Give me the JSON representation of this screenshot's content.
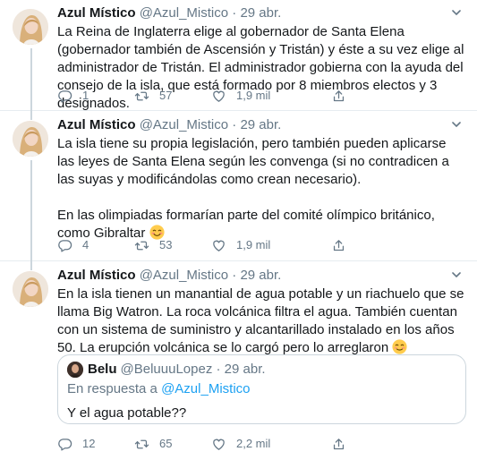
{
  "tweets": [
    {
      "author": {
        "name": "Azul Místico",
        "handle": "@Azul_Mistico"
      },
      "separator": "·",
      "date": "29 abr.",
      "paragraphs": [
        "La Reina de Inglaterra elige al gobernador de Santa Elena (gobernador también de Ascensión y Tristán) y éste a su vez elige al administrador de Tristán. El administrador gobierna con la ayuda del consejo de la isla, que está formado por 8 miembros electos y 3 designados."
      ],
      "stats": {
        "replies": "1",
        "retweets": "57",
        "likes": "1,9 mil"
      }
    },
    {
      "author": {
        "name": "Azul Místico",
        "handle": "@Azul_Mistico"
      },
      "separator": "·",
      "date": "29 abr.",
      "paragraphs": [
        "La isla tiene su propia legislación, pero también pueden aplicarse las leyes de Santa Elena según les convenga (si no contradicen a las suyas y modificándolas como crean necesario).",
        "En las olimpiadas formarían parte del comité olímpico británico, como Gibraltar"
      ],
      "stats": {
        "replies": "4",
        "retweets": "53",
        "likes": "1,9 mil"
      }
    },
    {
      "author": {
        "name": "Azul Místico",
        "handle": "@Azul_Mistico"
      },
      "separator": "·",
      "date": "29 abr.",
      "paragraphs": [
        "En la isla tienen un manantial de agua potable y un riachuelo que se llama Big Watron. La roca volcánica filtra el agua. También cuentan con un sistema de suministro y alcantarillado instalado en los años 50. La erupción volcánica se lo cargó pero lo arreglaron"
      ],
      "quoted": {
        "name": "Belu",
        "handle": "@BeluuuLopez",
        "separator": "·",
        "date": "29 abr.",
        "replying_prefix": "En respuesta a",
        "replying_to": "@Azul_Mistico",
        "text": "Y el agua potable??"
      },
      "stats": {
        "replies": "12",
        "retweets": "65",
        "likes": "2,2 mil"
      }
    }
  ],
  "icons": {
    "reply": "reply-bubble-icon",
    "retweet": "retweet-arrows-icon",
    "like": "heart-icon",
    "share": "share-upload-icon",
    "more": "chevron-down-icon",
    "emoji_2": "smiling-face-with-smiling-eyes-emoji",
    "emoji_3": "smiling-face-emoji"
  },
  "colors": {
    "text": "#14171a",
    "secondary": "#657786",
    "link": "#1da1f2",
    "border": "#e6ecf0",
    "thread_line": "#ccd6dd"
  }
}
